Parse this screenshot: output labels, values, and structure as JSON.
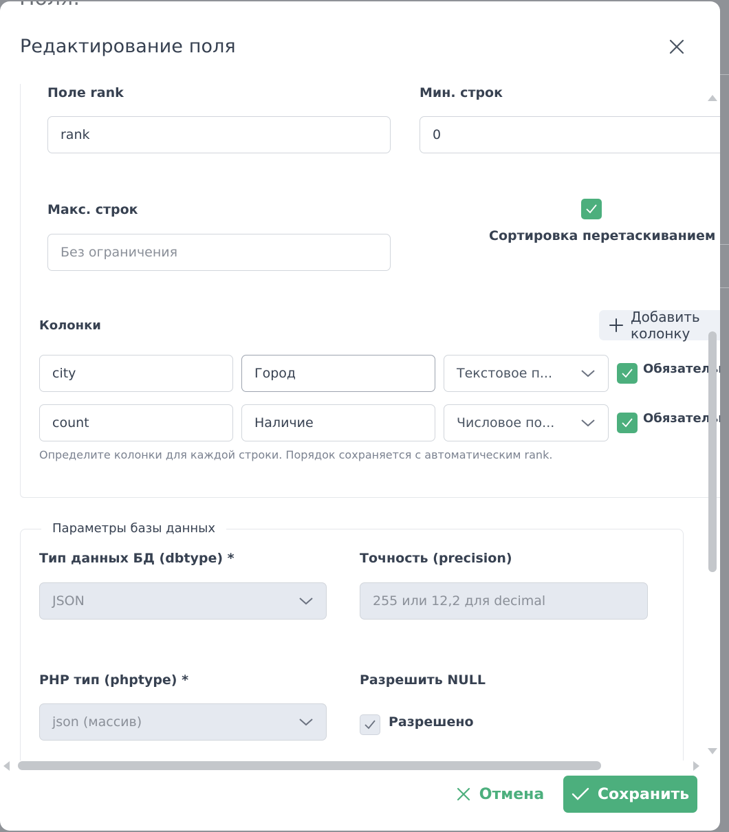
{
  "backdrop": {
    "title_fragment": "Поля:"
  },
  "modal": {
    "title": "Редактирование поля",
    "close_icon": "close-icon"
  },
  "table_settings": {
    "rank_field": {
      "label": "Поле rank",
      "value": "rank"
    },
    "min_rows": {
      "label": "Мин. строк",
      "value": "0"
    },
    "max_rows": {
      "label": "Макс. строк",
      "placeholder": "Без ограничения",
      "value": ""
    },
    "drag_sort": {
      "label": "Сортировка перетаскиванием",
      "checked": true
    },
    "columns": {
      "label": "Колонки",
      "add_button_label": "Добавить колонку",
      "rows": [
        {
          "key": "city",
          "title": "Город",
          "type": "Текстовое п...",
          "required_label": "Обязательное",
          "required": true
        },
        {
          "key": "count",
          "title": "Наличие",
          "type": "Числовое по...",
          "required_label": "Обязательное",
          "required": true
        }
      ],
      "help": "Определите колонки для каждой строки. Порядок сохраняется с автоматическим rank."
    }
  },
  "db_params": {
    "legend": "Параметры базы данных",
    "dbtype": {
      "label": "Тип данных БД (dbtype) *",
      "value": "JSON"
    },
    "precision": {
      "label": "Точность (precision)",
      "placeholder": "255 или 12,2 для decimal"
    },
    "phptype": {
      "label": "PHP тип (phptype) *",
      "value": "json (массив)"
    },
    "allow_null": {
      "label": "Разрешить NULL",
      "checkbox_label": "Разрешено",
      "checked": true
    }
  },
  "footer": {
    "cancel_label": "Отмена",
    "save_label": "Сохранить"
  },
  "colors": {
    "accent": "#4caf7d",
    "disabled_bg": "#e5e9f0",
    "text": "#374151"
  }
}
